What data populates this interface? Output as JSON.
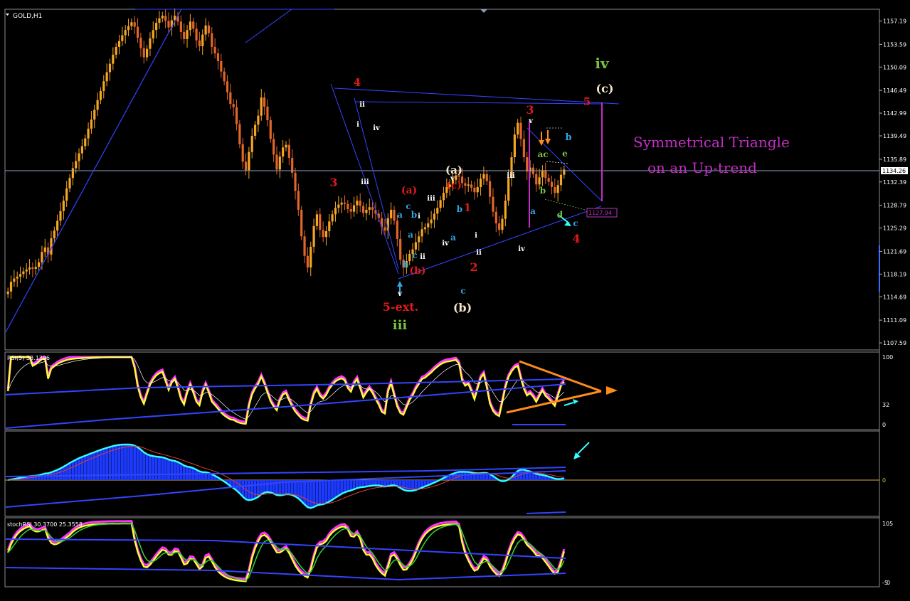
{
  "window": {
    "symbol_label": "GOLD,H1"
  },
  "colors": {
    "background": "#000000",
    "bull": "#f5a623",
    "bear": "#e0662a",
    "trendline": "#3344ff",
    "triangle": "#c22fc2",
    "wave_red": "#e01b1b",
    "wave_green": "#7ac143",
    "wave_cyan": "#2ea7e0",
    "wave_cream": "#f3e6c8",
    "rsi_line": "#ffff33",
    "rsi_signal": "#ff33ff",
    "macd_hist": "#1d3bff",
    "macd_line": "#33ffff",
    "orange_arrow": "#ff8c1a"
  },
  "price_axis": {
    "ticks": [
      "1157.19",
      "1153.59",
      "1150.09",
      "1146.49",
      "1142.99",
      "1139.49",
      "1135.89",
      "1132.39",
      "1128.79",
      "1125.29",
      "1121.69",
      "1118.19",
      "1114.69",
      "1111.09",
      "1107.59"
    ],
    "current_price_label": "1134.26",
    "target_label": "1127.94"
  },
  "annotations": {
    "pattern_title_line1": "Symmetrical Triangle",
    "pattern_title_line2": "on an Up-trend"
  },
  "wave_labels": [
    {
      "text": "iv",
      "color": "green"
    },
    {
      "text": "(c)",
      "color": "cream"
    },
    {
      "text": "5",
      "color": "red"
    },
    {
      "text": "4",
      "color": "red"
    },
    {
      "text": "3",
      "color": "red"
    },
    {
      "text": "3",
      "color": "red"
    },
    {
      "text": "ii",
      "color": "white"
    },
    {
      "text": "i",
      "color": "white"
    },
    {
      "text": "iv",
      "color": "white"
    },
    {
      "text": "iii",
      "color": "white"
    },
    {
      "text": "(a)",
      "color": "red"
    },
    {
      "text": "(a)",
      "color": "cream"
    },
    {
      "text": "(c)",
      "color": "red"
    },
    {
      "text": "a",
      "color": "cyan"
    },
    {
      "text": "c",
      "color": "cyan"
    },
    {
      "text": "b",
      "color": "cyan"
    },
    {
      "text": "i",
      "color": "white"
    },
    {
      "text": "iii",
      "color": "white"
    },
    {
      "text": "v",
      "color": "white"
    },
    {
      "text": "b",
      "color": "cyan"
    },
    {
      "text": "1",
      "color": "red"
    },
    {
      "text": "a",
      "color": "cyan"
    },
    {
      "text": "a",
      "color": "cyan"
    },
    {
      "text": "iv",
      "color": "white"
    },
    {
      "text": "c",
      "color": "cyan"
    },
    {
      "text": "ii",
      "color": "white"
    },
    {
      "text": "b",
      "color": "cyan"
    },
    {
      "text": "(b)",
      "color": "red"
    },
    {
      "text": "v",
      "color": "white"
    },
    {
      "text": "5-ext.",
      "color": "red"
    },
    {
      "text": "iii",
      "color": "green"
    },
    {
      "text": "i",
      "color": "white"
    },
    {
      "text": "ii",
      "color": "white"
    },
    {
      "text": "2",
      "color": "red"
    },
    {
      "text": "c",
      "color": "cyan"
    },
    {
      "text": "(b)",
      "color": "cream"
    },
    {
      "text": "iii",
      "color": "white"
    },
    {
      "text": "iv",
      "color": "white"
    },
    {
      "text": "v",
      "color": "white"
    },
    {
      "text": "b",
      "color": "cyan"
    },
    {
      "text": "ac",
      "color": "green"
    },
    {
      "text": "e",
      "color": "green"
    },
    {
      "text": "b",
      "color": "green"
    },
    {
      "text": "a",
      "color": "cyan"
    },
    {
      "text": "d",
      "color": "green"
    },
    {
      "text": "c",
      "color": "cyan"
    },
    {
      "text": "4",
      "color": "red"
    }
  ],
  "rsi_panel": {
    "label": "RSI(5) 58.1396",
    "levels": [
      "100",
      "32",
      "0"
    ]
  },
  "macd_panel": {
    "label": "",
    "zero_label": "0"
  },
  "stoch_panel": {
    "label": "stochRSI 30.3700 25.3558",
    "levels": [
      "105",
      "-5",
      "0"
    ]
  },
  "chart_data": {
    "type": "candlestick",
    "symbol": "GOLD",
    "timeframe": "H1",
    "ylim": [
      1106.5,
      1159.0
    ],
    "closes": [
      1115.5,
      1117.0,
      1117.5,
      1117.8,
      1118.2,
      1118.6,
      1118.9,
      1119.2,
      1119.0,
      1119.3,
      1120.0,
      1121.6,
      1122.3,
      1121.2,
      1123.7,
      1124.9,
      1126.4,
      1127.9,
      1129.5,
      1131.4,
      1133.0,
      1134.5,
      1135.6,
      1136.8,
      1137.9,
      1139.1,
      1140.6,
      1142.0,
      1143.5,
      1145.0,
      1146.4,
      1147.9,
      1149.3,
      1150.6,
      1152.0,
      1153.2,
      1154.1,
      1155.0,
      1155.8,
      1156.4,
      1157.0,
      1156.3,
      1154.6,
      1153.0,
      1151.6,
      1152.9,
      1154.5,
      1155.8,
      1156.9,
      1157.6,
      1158.0,
      1157.2,
      1156.2,
      1157.3,
      1158.0,
      1157.1,
      1155.5,
      1154.4,
      1155.8,
      1157.1,
      1156.0,
      1154.2,
      1153.3,
      1155.1,
      1156.5,
      1155.3,
      1153.2,
      1152.2,
      1151.0,
      1149.4,
      1147.9,
      1146.2,
      1144.4,
      1143.9,
      1141.3,
      1138.2,
      1135.5,
      1134.2,
      1137.0,
      1139.5,
      1141.2,
      1142.6,
      1145.4,
      1144.0,
      1141.9,
      1139.0,
      1136.6,
      1134.3,
      1136.3,
      1137.7,
      1138.1,
      1136.1,
      1133.8,
      1131.0,
      1128.1,
      1124.0,
      1121.0,
      1119.2,
      1122.4,
      1125.6,
      1127.4,
      1125.0,
      1123.9,
      1124.8,
      1126.3,
      1127.4,
      1128.4,
      1128.9,
      1129.2,
      1129.0,
      1128.2,
      1127.8,
      1128.8,
      1129.5,
      1128.7,
      1127.6,
      1128.1,
      1128.5,
      1128.1,
      1127.5,
      1126.8,
      1125.4,
      1124.9,
      1126.8,
      1128.1,
      1126.4,
      1123.6,
      1120.4,
      1119.2,
      1120.2,
      1121.3,
      1122.0,
      1123.1,
      1124.0,
      1125.1,
      1125.4,
      1126.0,
      1126.6,
      1127.5,
      1128.4,
      1129.6,
      1130.7,
      1131.6,
      1132.0,
      1132.7,
      1133.4,
      1133.2,
      1132.2,
      1131.8,
      1132.0,
      1131.5,
      1130.8,
      1131.6,
      1132.9,
      1133.6,
      1132.5,
      1130.1,
      1127.8,
      1126.0,
      1125.0,
      1126.7,
      1129.5,
      1133.0,
      1136.2,
      1139.7,
      1141.5,
      1139.0,
      1136.2,
      1134.0,
      1134.6,
      1133.6,
      1132.0,
      1133.1,
      1134.2,
      1133.0,
      1132.4,
      1131.6,
      1130.7,
      1131.9,
      1133.5,
      1134.3
    ],
    "trendlines": [
      {
        "name": "upper resistance",
        "x": [
          0.367,
          0.68
        ],
        "y": [
          1146.8,
          1144.4
        ]
      },
      {
        "name": "lower support",
        "x": [
          0.435,
          0.68
        ],
        "y": [
          1117.6,
          1129.5
        ]
      },
      {
        "name": "target level",
        "y": 1127.94
      }
    ],
    "rsi": {
      "ylim": [
        0,
        100
      ],
      "levels": [
        100,
        32,
        0
      ],
      "last": 58.1396
    },
    "stochrsi": {
      "ylim": [
        -5,
        105
      ],
      "main": 30.37,
      "signal": 25.3558
    }
  }
}
